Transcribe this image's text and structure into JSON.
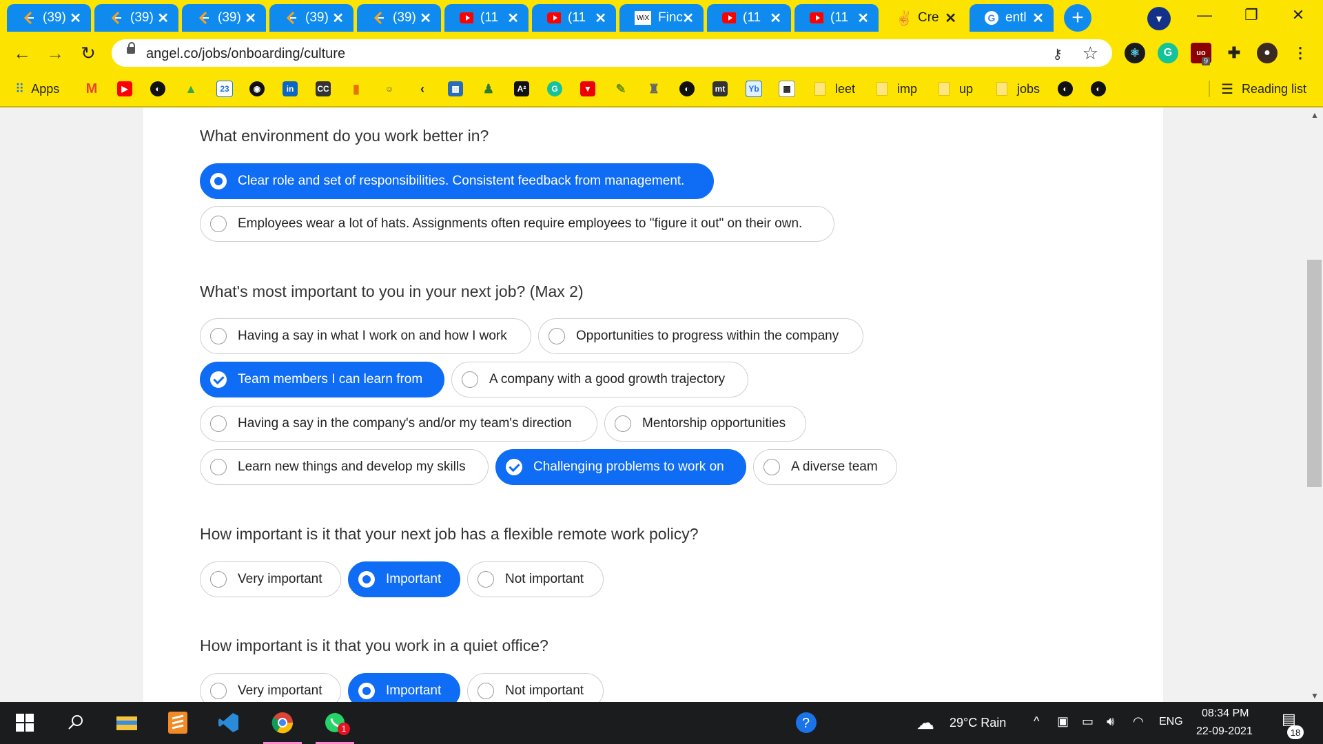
{
  "tabs": [
    {
      "title": "(39)",
      "icon": "leetcode-icon"
    },
    {
      "title": "(39)",
      "icon": "leetcode-icon"
    },
    {
      "title": "(39)",
      "icon": "leetcode-icon"
    },
    {
      "title": "(39)",
      "icon": "leetcode-icon"
    },
    {
      "title": "(39)",
      "icon": "leetcode-icon"
    },
    {
      "title": "(11",
      "icon": "youtube-icon"
    },
    {
      "title": "(11",
      "icon": "youtube-icon"
    },
    {
      "title": "Finc",
      "icon": "wix-icon"
    },
    {
      "title": "(11",
      "icon": "youtube-icon"
    },
    {
      "title": "(11",
      "icon": "youtube-icon"
    },
    {
      "title": "Cre",
      "icon": "angellist-icon"
    },
    {
      "title": "entl",
      "icon": "google-icon"
    }
  ],
  "active_tab_index": 10,
  "address_bar": {
    "url": "angel.co/jobs/onboarding/culture"
  },
  "bookmarks": {
    "apps_label": "Apps",
    "folders": [
      "leet",
      "imp",
      "up",
      "jobs"
    ],
    "reading_list": "Reading list"
  },
  "questions": [
    {
      "text": "What environment do you work better in?",
      "type": "radio",
      "options": [
        {
          "label": "Clear role and set of responsibilities. Consistent feedback from management.",
          "selected": true
        },
        {
          "label": "Employees wear a lot of hats. Assignments often require employees to \"figure it out\" on their own.",
          "selected": false
        }
      ]
    },
    {
      "text": "What's most important to you in your next job? (Max 2)",
      "type": "checkbox",
      "options": [
        {
          "label": "Having a say in what I work on and how I work",
          "selected": false
        },
        {
          "label": "Opportunities to progress within the company",
          "selected": false
        },
        {
          "label": "Team members I can learn from",
          "selected": true
        },
        {
          "label": "A company with a good growth trajectory",
          "selected": false
        },
        {
          "label": "Having a say in the company's and/or my team's direction",
          "selected": false
        },
        {
          "label": "Mentorship opportunities",
          "selected": false
        },
        {
          "label": "Learn new things and develop my skills",
          "selected": false
        },
        {
          "label": "Challenging problems to work on",
          "selected": true
        },
        {
          "label": "A diverse team",
          "selected": false
        }
      ]
    },
    {
      "text": "How important is it that your next job has a flexible remote work policy?",
      "type": "radio",
      "options": [
        {
          "label": "Very important",
          "selected": false
        },
        {
          "label": "Important",
          "selected": true
        },
        {
          "label": "Not important",
          "selected": false
        }
      ]
    },
    {
      "text": "How important is it that you work in a quiet office?",
      "type": "radio",
      "options": [
        {
          "label": "Very important",
          "selected": false
        },
        {
          "label": "Important",
          "selected": true
        },
        {
          "label": "Not important",
          "selected": false
        }
      ]
    }
  ],
  "taskbar": {
    "weather": "29°C Rain",
    "language": "ENG",
    "time": "08:34 PM",
    "date": "22-09-2021",
    "notification_count": "18",
    "whatsapp_badge": "1",
    "extension_badge": "9"
  },
  "colors": {
    "chrome_theme": "#fde400",
    "tab_inactive": "#0f8bf0",
    "selected_option": "#0f6cf5"
  }
}
